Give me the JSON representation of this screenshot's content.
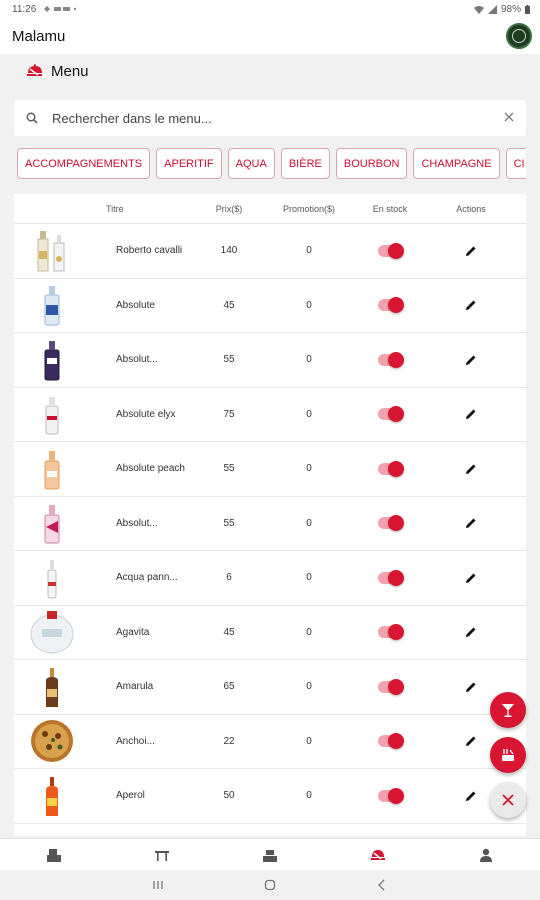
{
  "status_bar": {
    "time": "11:26",
    "battery": "98%"
  },
  "app_bar": {
    "title": "Malamu"
  },
  "section": {
    "title": "Menu"
  },
  "search": {
    "placeholder": "Rechercher dans le menu..."
  },
  "categories": [
    "ACCOMPAGNEMENTS",
    "APERITIF",
    "AQUA",
    "BIÈRE",
    "BOURBON",
    "CHAMPAGNE",
    "CI"
  ],
  "table": {
    "headers": {
      "title": "Titre",
      "price": "Prix($)",
      "promo": "Promotion($)",
      "stock": "En stock",
      "actions": "Actions"
    },
    "rows": [
      {
        "title": "Roberto cavalli",
        "price": "140",
        "promo": "0",
        "in_stock": true,
        "image": "bottle-cavalli"
      },
      {
        "title": "Absolute",
        "price": "45",
        "promo": "0",
        "in_stock": true,
        "image": "bottle-blue"
      },
      {
        "title": "Absolut...",
        "price": "55",
        "promo": "0",
        "in_stock": true,
        "image": "bottle-purple"
      },
      {
        "title": "Absolute elyx",
        "price": "75",
        "promo": "0",
        "in_stock": true,
        "image": "bottle-clear"
      },
      {
        "title": "Absolute peach",
        "price": "55",
        "promo": "0",
        "in_stock": true,
        "image": "bottle-peach"
      },
      {
        "title": "Absolut...",
        "price": "55",
        "promo": "0",
        "in_stock": true,
        "image": "bottle-pink"
      },
      {
        "title": "Acqua pann...",
        "price": "6",
        "promo": "0",
        "in_stock": true,
        "image": "bottle-water"
      },
      {
        "title": "Agavita",
        "price": "45",
        "promo": "0",
        "in_stock": true,
        "image": "bottle-agavita"
      },
      {
        "title": "Amarula",
        "price": "65",
        "promo": "0",
        "in_stock": true,
        "image": "bottle-amarula"
      },
      {
        "title": "Anchoi...",
        "price": "22",
        "promo": "0",
        "in_stock": true,
        "image": "dish-pizza"
      },
      {
        "title": "Aperol",
        "price": "50",
        "promo": "0",
        "in_stock": true,
        "image": "bottle-aperol"
      }
    ]
  },
  "colors": {
    "accent": "#d81631",
    "chip_border": "#d7a6ad",
    "toggle_track": "#f2a2ae"
  }
}
